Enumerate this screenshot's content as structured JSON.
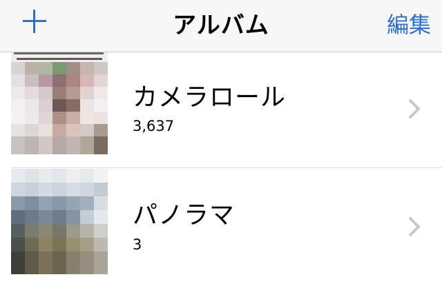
{
  "navbar": {
    "title": "アルバム",
    "edit_label": "編集",
    "add_icon": "plus-icon"
  },
  "albums": [
    {
      "name": "カメラロール",
      "count": "3,637",
      "thumbnail": "pixelated-photo-person"
    },
    {
      "name": "パノラマ",
      "count": "3",
      "thumbnail": "pixelated-photo-landscape"
    }
  ],
  "colors": {
    "accent": "#2c6fdc",
    "navbar_bg": "#f7f7f8",
    "chevron": "#c7c7cc",
    "separator": "#e2e2e4"
  }
}
